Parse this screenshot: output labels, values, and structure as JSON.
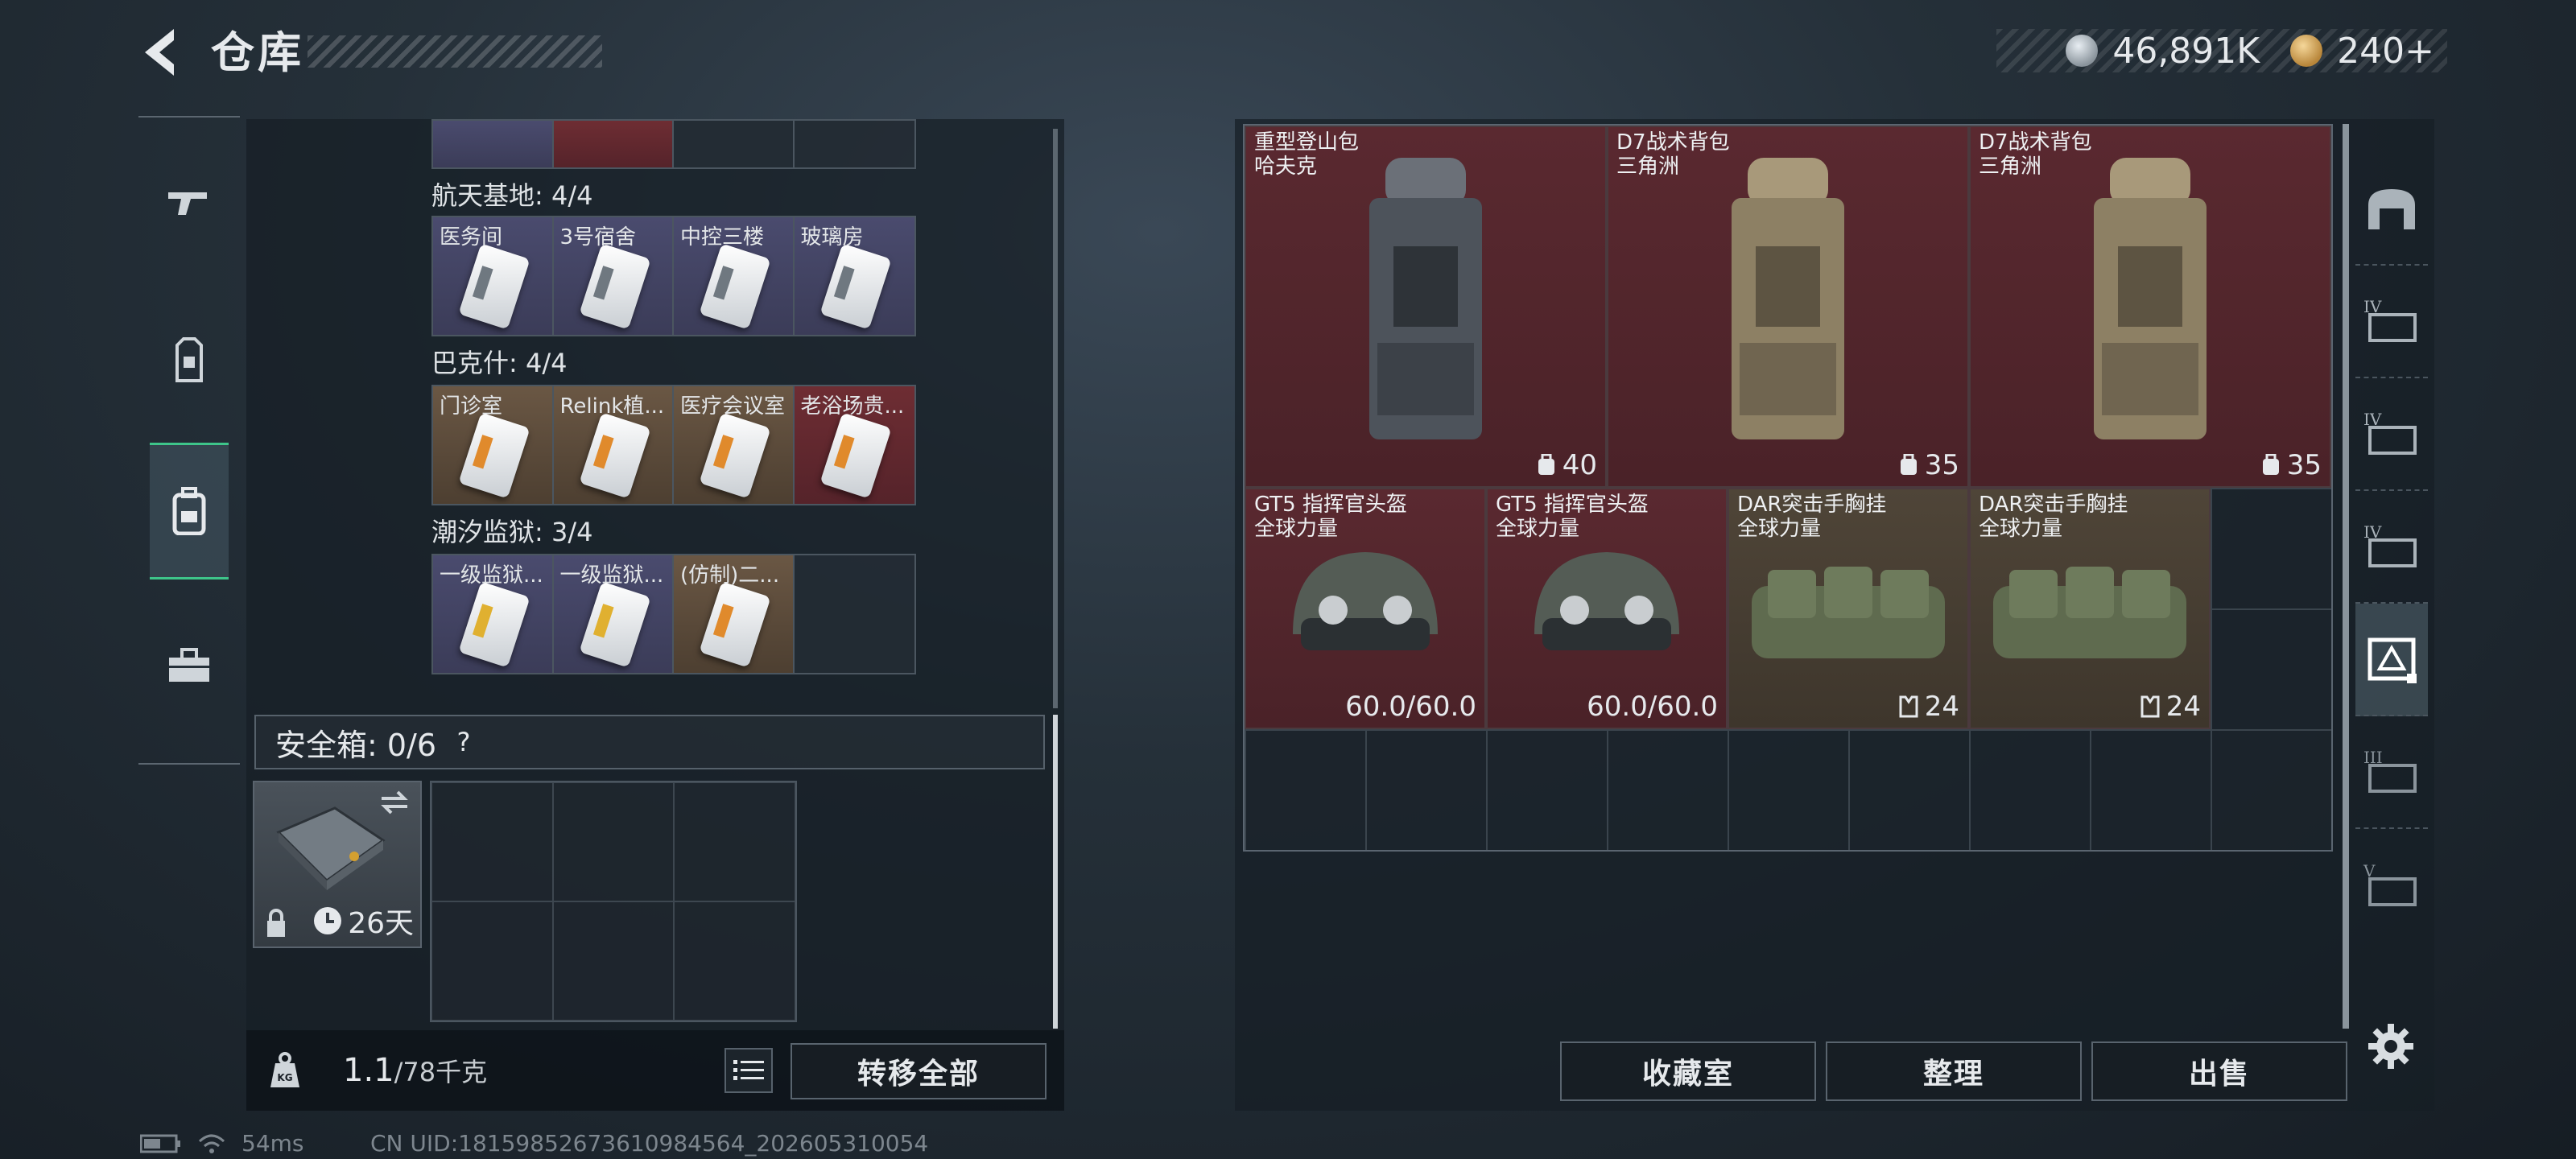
{
  "header": {
    "title": "仓库"
  },
  "currency": {
    "silver": "46,891K",
    "gold": "240+"
  },
  "left": {
    "sections": [
      {
        "title": "航天基地: 4/4",
        "cards": [
          {
            "label": "医务间",
            "rarity": "purple"
          },
          {
            "label": "3号宿舍",
            "rarity": "purple"
          },
          {
            "label": "中控三楼",
            "rarity": "purple"
          },
          {
            "label": "玻璃房",
            "rarity": "purple"
          }
        ]
      },
      {
        "title": "巴克什: 4/4",
        "cards": [
          {
            "label": "门诊室",
            "rarity": "gold"
          },
          {
            "label": "Relink植...",
            "rarity": "gold"
          },
          {
            "label": "医疗会议室",
            "rarity": "gold"
          },
          {
            "label": "老浴场贵...",
            "rarity": "red"
          }
        ]
      },
      {
        "title": "潮汐监狱: 3/4",
        "cards": [
          {
            "label": "一级监狱...",
            "rarity": "purple"
          },
          {
            "label": "一级监狱...",
            "rarity": "purple"
          },
          {
            "label": "(仿制)二...",
            "rarity": "gold"
          }
        ]
      }
    ],
    "safebox": {
      "label": "安全箱: 0/6",
      "help": "?",
      "timer": "26天"
    },
    "weight": {
      "current": "1.1",
      "max": "/78千克"
    },
    "transfer_all": "转移全部"
  },
  "stash": {
    "items": [
      {
        "name": "重型登山包",
        "sub": "哈夫克",
        "stat": "40",
        "color": "red"
      },
      {
        "name": "D7战术背包",
        "sub": "三角洲",
        "stat": "35",
        "color": "red"
      },
      {
        "name": "D7战术背包",
        "sub": "三角洲",
        "stat": "35",
        "color": "red"
      },
      {
        "name": "GT5 指挥官头盔",
        "sub": "全球力量",
        "stat": "60.0/60.0",
        "color": "red"
      },
      {
        "name": "GT5 指挥官头盔",
        "sub": "全球力量",
        "stat": "60.0/60.0",
        "color": "red"
      },
      {
        "name": "DAR突击手胸挂",
        "sub": "全球力量",
        "stat": "24",
        "color": "gold"
      },
      {
        "name": "DAR突击手胸挂",
        "sub": "全球力量",
        "stat": "24",
        "color": "gold"
      }
    ],
    "buttons": {
      "collection": "收藏室",
      "sort": "整理",
      "sell": "出售"
    }
  },
  "right_rail": {
    "labels": [
      "IV",
      "IV",
      "IV",
      "III",
      "V"
    ]
  },
  "status": {
    "ping": "54ms",
    "uid": "CN UID:18159852673610984564_202605310054"
  },
  "colors": {
    "accent": "#3ec58a",
    "red_rarity": "#5a2930",
    "gold_rarity": "#4f4538",
    "purple_rarity": "#4a4b6e"
  }
}
